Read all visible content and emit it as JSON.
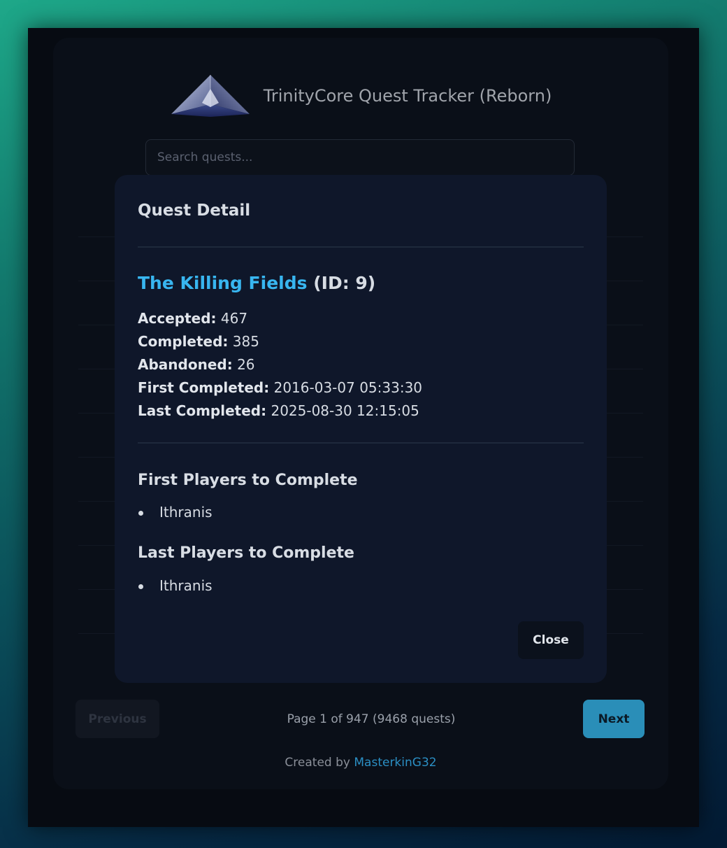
{
  "app": {
    "title": "TrinityCore Quest Tracker (Reborn)",
    "logo_icon": "pyramid-logo-icon"
  },
  "search": {
    "placeholder": "Search quests..."
  },
  "pagination": {
    "previous_label": "Previous",
    "next_label": "Next",
    "page_info": "Page 1 of 947 (9468 quests)"
  },
  "footer": {
    "prefix": "Created by",
    "author": "MasterkinG32"
  },
  "modal": {
    "title": "Quest Detail",
    "quest_name": "The Killing Fields",
    "quest_id_text": "(ID: 9)",
    "stats": [
      {
        "label": "Accepted:",
        "value": "467"
      },
      {
        "label": "Completed:",
        "value": "385"
      },
      {
        "label": "Abandoned:",
        "value": "26"
      },
      {
        "label": "First Completed:",
        "value": "2016-03-07 05:33:30"
      },
      {
        "label": "Last Completed:",
        "value": "2025-08-30 12:15:05"
      }
    ],
    "first_players_title": "First Players to Complete",
    "first_players": [
      "Ithranis"
    ],
    "last_players_title": "Last Players to Complete",
    "last_players": [
      "Ithranis"
    ],
    "close_label": "Close"
  },
  "colors": {
    "accent": "#38b6f0",
    "next_button": "#2a8eb8",
    "link": "#2b8fc4",
    "modal_bg": "#0f172a"
  }
}
